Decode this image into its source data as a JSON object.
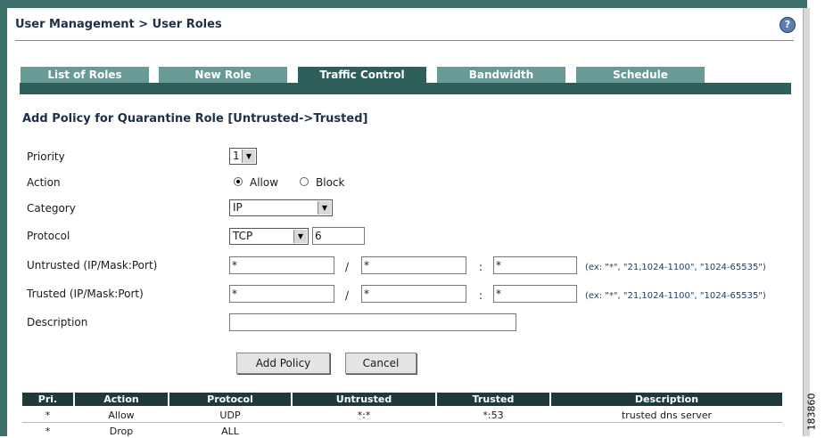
{
  "breadcrumb": "User Management > User Roles",
  "help_icon": "?",
  "tabs": [
    {
      "label": "List of Roles"
    },
    {
      "label": "New Role"
    },
    {
      "label": "Traffic Control"
    },
    {
      "label": "Bandwidth"
    },
    {
      "label": "Schedule"
    }
  ],
  "section_title": "Add Policy for Quarantine Role [Untrusted->Trusted]",
  "form": {
    "priority_label": "Priority",
    "priority_value": "1",
    "action_label": "Action",
    "action_allow": "Allow",
    "action_block": "Block",
    "category_label": "Category",
    "category_value": "IP",
    "protocol_label": "Protocol",
    "protocol_value": "TCP",
    "protocol_number": "6",
    "untrusted_label": "Untrusted (IP/Mask:Port)",
    "untrusted_ip": "*",
    "untrusted_mask": "*",
    "untrusted_port": "*",
    "trusted_label": "Trusted (IP/Mask:Port)",
    "trusted_ip": "*",
    "trusted_mask": "*",
    "trusted_port": "*",
    "slash": "/",
    "colon": ":",
    "port_hint": "(ex: \"*\", \"21,1024-1100\", \"1024-65535\")",
    "description_label": "Description",
    "description_value": ""
  },
  "buttons": {
    "add_policy": "Add Policy",
    "cancel": "Cancel"
  },
  "table": {
    "headers": [
      "Pri.",
      "Action",
      "Protocol",
      "Untrusted",
      "Trusted",
      "Description"
    ],
    "rows": [
      [
        "*",
        "Allow",
        "UDP",
        "*:*",
        "*:53",
        "trusted dns server"
      ],
      [
        "*",
        "Drop",
        "ALL",
        "",
        "",
        ""
      ]
    ]
  },
  "figure_id": "183860"
}
